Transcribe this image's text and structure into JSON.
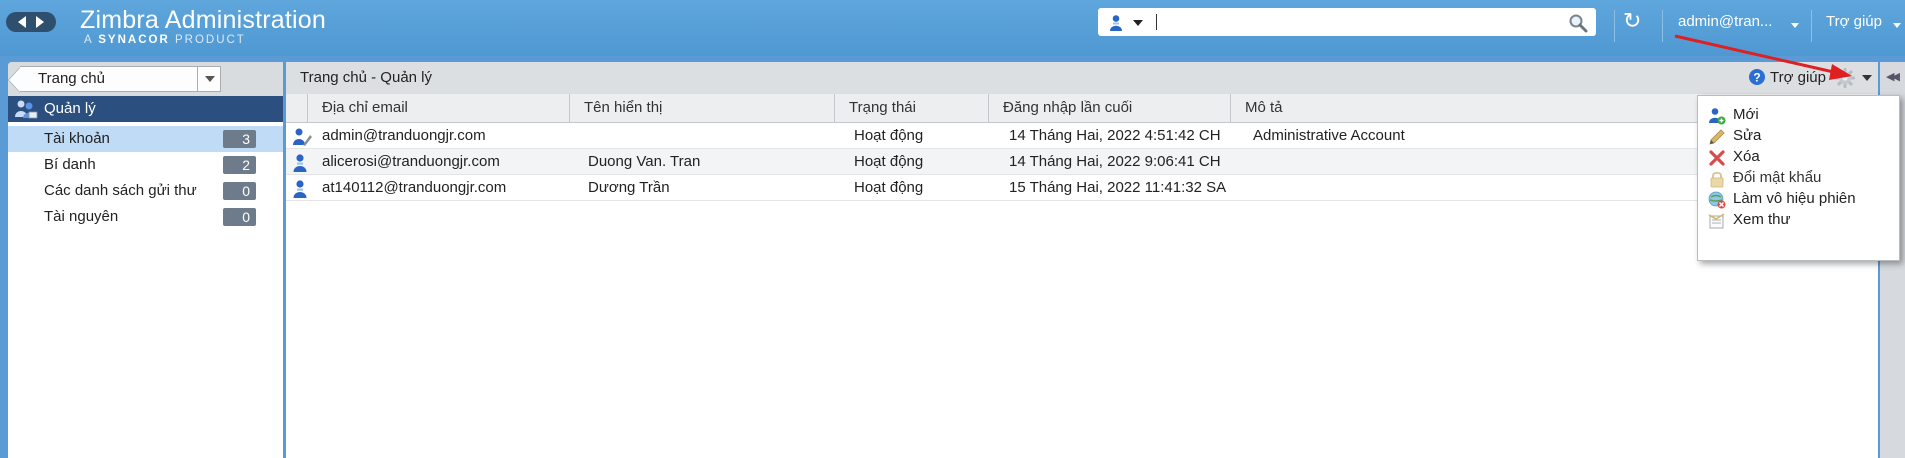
{
  "header": {
    "app_title": "Zimbra Administration",
    "app_subtitle_prefix": "A",
    "app_subtitle_brand": "SYNACOR",
    "app_subtitle_suffix": "PRODUCT",
    "search_value": "",
    "user": "admin@tran...",
    "help": "Trợ giúp"
  },
  "sidebar": {
    "home_dropdown": "Trang chủ",
    "section_title": "Quản lý",
    "items": [
      {
        "label": "Tài khoản",
        "count": "3",
        "selected": true
      },
      {
        "label": "Bí danh",
        "count": "2",
        "selected": false
      },
      {
        "label": "Các danh sách gửi thư",
        "count": "0",
        "selected": false
      },
      {
        "label": "Tài nguyên",
        "count": "0",
        "selected": false
      }
    ]
  },
  "main": {
    "breadcrumb": "Trang chủ - Quản lý",
    "help": "Trợ giúp",
    "columns": [
      "Địa chỉ email",
      "Tên hiển thị",
      "Trạng thái",
      "Đăng nhập lần cuối",
      "Mô tả"
    ],
    "rows": [
      {
        "icon": "admin-user-icon",
        "email": "admin@tranduongjr.com",
        "display_name": "",
        "status": "Hoạt động",
        "last_login": "14 Tháng Hai, 2022 4:51:42 CH",
        "description": "Administrative Account"
      },
      {
        "icon": "user-icon",
        "email": "alicerosi@tranduongjr.com",
        "display_name": "Duong Van. Tran",
        "status": "Hoạt động",
        "last_login": "14 Tháng Hai, 2022 9:06:41 CH",
        "description": ""
      },
      {
        "icon": "user-icon",
        "email": "at140112@tranduongjr.com",
        "display_name": "Dương Trần",
        "status": "Hoạt động",
        "last_login": "15 Tháng Hai, 2022 11:41:32 SA",
        "description": ""
      }
    ]
  },
  "action_menu": {
    "items": [
      {
        "label": "Mới",
        "icon": "new-user-icon",
        "enabled": true
      },
      {
        "label": "Sửa",
        "icon": "edit-pencil-icon",
        "enabled": true
      },
      {
        "label": "Xóa",
        "icon": "delete-x-icon",
        "enabled": true
      },
      {
        "label": "Đổi mật khẩu",
        "icon": "lock-icon",
        "enabled": false
      },
      {
        "label": "Làm vô hiệu phiên",
        "icon": "invalidate-session-icon",
        "enabled": true
      },
      {
        "label": "Xem thư",
        "icon": "view-mail-icon",
        "enabled": true
      }
    ]
  },
  "colors": {
    "header_bg": "#5a9bd5",
    "section_header": "#2b4f7e",
    "selected_item": "#bfdbf6",
    "annotation_arrow": "#e02020"
  }
}
